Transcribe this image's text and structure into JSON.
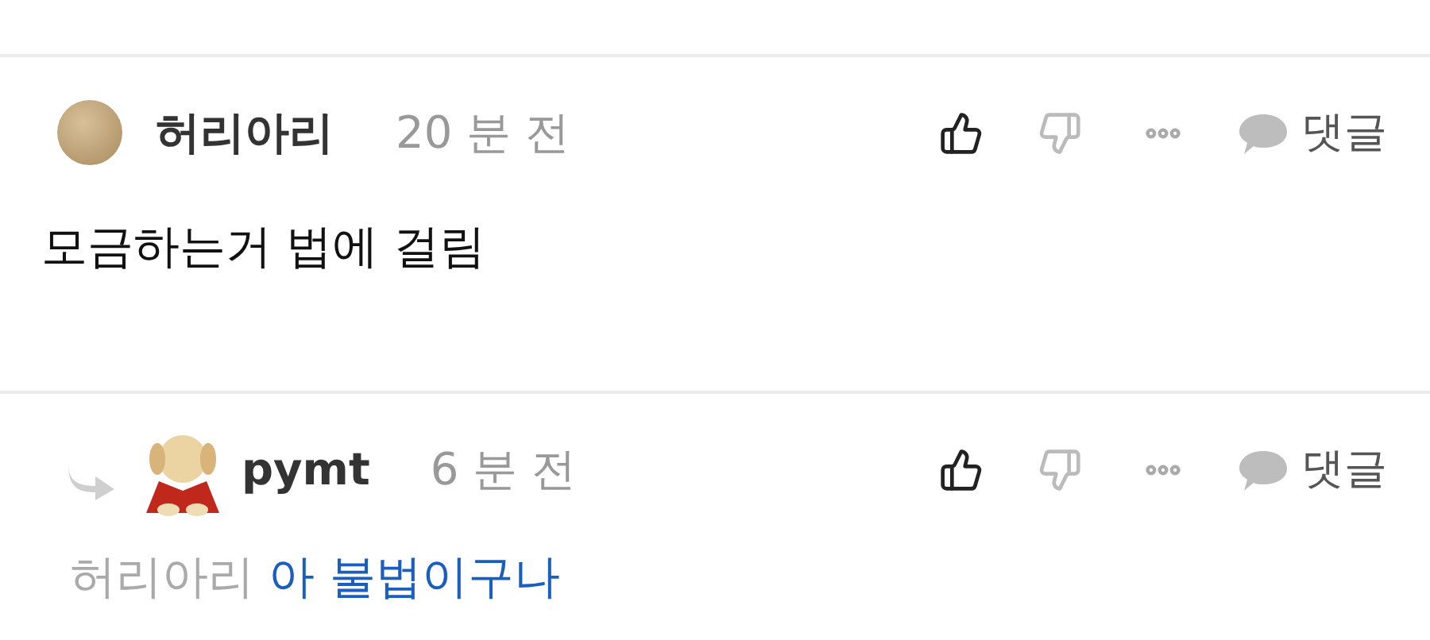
{
  "comments": [
    {
      "kind": "comment",
      "author": "허리아리",
      "time": "20 분 전",
      "reply_label": "댓글",
      "body": "모금하는거 법에 걸림"
    },
    {
      "kind": "reply",
      "author": "pymt",
      "time": "6 분 전",
      "reply_label": "댓글",
      "mention": "허리아리",
      "body": "아 불법이구나"
    }
  ]
}
